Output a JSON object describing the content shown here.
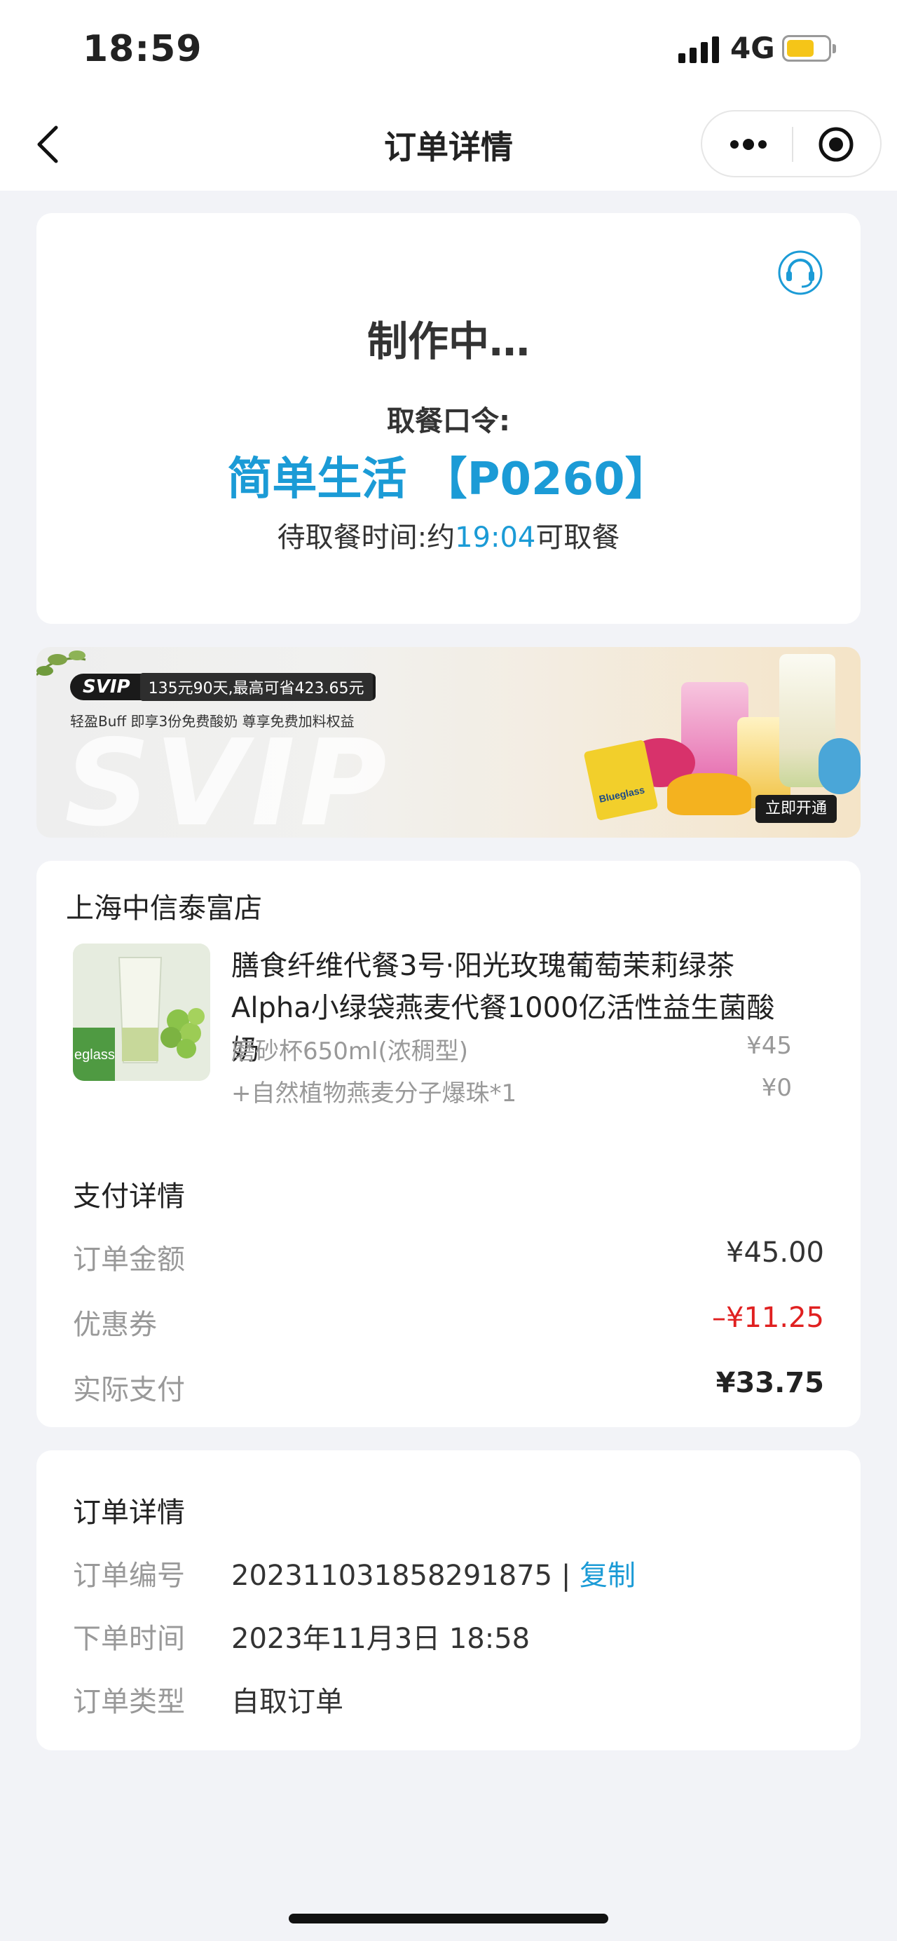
{
  "status_bar": {
    "time": "18:59",
    "network": "4G"
  },
  "nav": {
    "title": "订单详情"
  },
  "status_card": {
    "status": "制作中…",
    "pickup_label": "取餐口令:",
    "pickup_code": "简单生活 【P0260】",
    "wait_prefix": "待取餐时间:约",
    "wait_time": "19:04",
    "wait_suffix": "可取餐"
  },
  "banner": {
    "badge": "SVIP",
    "price_text": "135元90天,最高可省423.65元",
    "subtitle": "轻盈Buff  即享3份免费酸奶  尊享免费加料权益",
    "watermark": "SVIP",
    "button": "立即开通",
    "brand": "Blueglass"
  },
  "store": {
    "name": "上海中信泰富店",
    "product": {
      "thumb_label": "eglass",
      "name": "膳食纤维代餐3号·阳光玫瑰葡萄茉莉绿茶Alpha小绿袋燕麦代餐1000亿活性益生菌酸奶",
      "spec": "磨砂杯650ml(浓稠型)",
      "spec_price": "¥45",
      "addon": "+自然植物燕麦分子爆珠*1",
      "addon_price": "¥0"
    }
  },
  "payment": {
    "title": "支付详情",
    "rows": [
      {
        "label": "订单金额",
        "value": "¥45.00"
      },
      {
        "label": "优惠券",
        "value": "–¥11.25"
      },
      {
        "label": "实际支付",
        "value": "¥33.75"
      }
    ]
  },
  "order_details": {
    "title": "订单详情",
    "order_no_label": "订单编号",
    "order_no": "202311031858291875",
    "separator": "|",
    "copy": "复制",
    "time_label": "下单时间",
    "time": "2023年11月3日 18:58",
    "type_label": "订单类型",
    "type": "自取订单"
  },
  "colors": {
    "accent": "#1b9bd6",
    "discount": "#e02020",
    "background": "#f2f3f7"
  },
  "icons": [
    "back-arrow-icon",
    "more-dots-icon",
    "target-icon",
    "headset-icon"
  ]
}
